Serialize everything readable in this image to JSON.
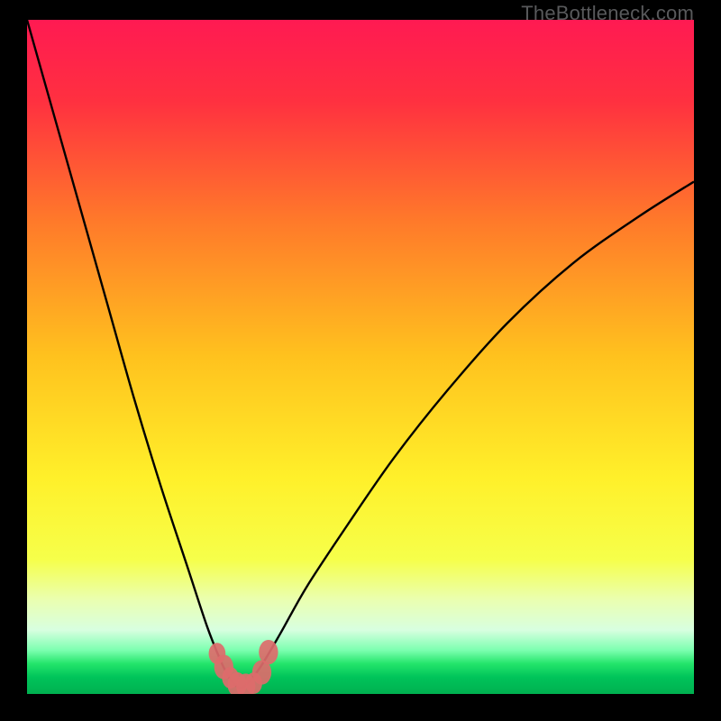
{
  "watermark": "TheBottleneck.com",
  "chart_data": {
    "type": "line",
    "title": "",
    "xlabel": "",
    "ylabel": "",
    "xlim": [
      0,
      100
    ],
    "ylim": [
      0,
      100
    ],
    "optimum_x": 32,
    "curve_left": {
      "x": [
        0,
        4,
        8,
        12,
        16,
        20,
        24,
        27,
        29,
        30,
        31,
        32
      ],
      "y": [
        100,
        86,
        72,
        58,
        44,
        31,
        19,
        10,
        5,
        3,
        1.5,
        0.8
      ]
    },
    "curve_right": {
      "x": [
        32,
        33,
        35,
        38,
        42,
        48,
        55,
        63,
        72,
        82,
        92,
        100
      ],
      "y": [
        0.8,
        1.5,
        4,
        9,
        16,
        25,
        35,
        45,
        55,
        64,
        71,
        76
      ]
    },
    "markers": [
      {
        "x": 28.5,
        "y": 6.0,
        "r": 1.4
      },
      {
        "x": 29.5,
        "y": 4.0,
        "r": 1.6
      },
      {
        "x": 30.5,
        "y": 2.4,
        "r": 1.4
      },
      {
        "x": 31.5,
        "y": 1.4,
        "r": 1.6
      },
      {
        "x": 32.8,
        "y": 1.2,
        "r": 1.6
      },
      {
        "x": 34.0,
        "y": 1.6,
        "r": 1.4
      },
      {
        "x": 35.2,
        "y": 3.2,
        "r": 1.6
      },
      {
        "x": 36.2,
        "y": 6.2,
        "r": 1.6
      }
    ],
    "gradient_stops": [
      {
        "t": 0.0,
        "c": "#ff1a52"
      },
      {
        "t": 0.12,
        "c": "#ff3040"
      },
      {
        "t": 0.3,
        "c": "#ff7a2a"
      },
      {
        "t": 0.5,
        "c": "#ffc21e"
      },
      {
        "t": 0.68,
        "c": "#fff02a"
      },
      {
        "t": 0.8,
        "c": "#f6ff4a"
      },
      {
        "t": 0.86,
        "c": "#eaffb0"
      },
      {
        "t": 0.905,
        "c": "#d8ffe0"
      },
      {
        "t": 0.935,
        "c": "#7cffb0"
      },
      {
        "t": 0.955,
        "c": "#24e56b"
      },
      {
        "t": 0.975,
        "c": "#00c45a"
      },
      {
        "t": 1.0,
        "c": "#00b050"
      }
    ],
    "colors": {
      "curve": "#000000",
      "marker": "#dd6b6b"
    }
  }
}
